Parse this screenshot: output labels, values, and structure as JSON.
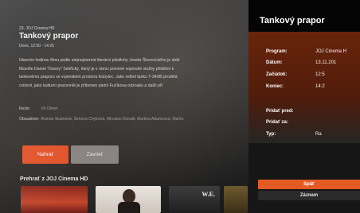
{
  "detail": {
    "channel_line": "23. JOJ Cinema HD",
    "title": "Tankový prapor",
    "time": "Dnes, 12:50 - 14:25",
    "description_lines": [
      "Hlavním hrdinou filmu podle stejnojmenné literární předlohy Josefa Škvoreckého je dokt",
      "filosofie Daniel \"Danny\" Smiřický, který je v rámci povinné vojenské služby přidělen k",
      "tankovému praporu ve vojenském prostoru Kobylec. Jako velitel tanku T-34/85 prodělá",
      "cvičení, jako kulturní pracovník je přítomen pietní Fučíkova odznaku a další při"
    ],
    "director_label": "Režie:",
    "director_value": "Vít Olmer",
    "cast_label": "Obsadenie:",
    "cast_value": "Roman Skamene, Simona Chytrová, Miroslav Donutil, Martina Adamcová, Martin",
    "record_button": "Nahrať",
    "close_button": "Zavrieť",
    "related_title": "Prehrať z JOJ Cinema HD",
    "thumb3_text": "W.E."
  },
  "panel": {
    "title": "Tankový prapor",
    "rows": [
      {
        "label": "Program:",
        "value": "JOJ Cinema H"
      },
      {
        "label": "Dátum:",
        "value": "13.11.201"
      },
      {
        "label": "Začiatok:",
        "value": "12:5"
      },
      {
        "label": "Koniec:",
        "value": "14:2"
      },
      {
        "label": "Pridať pred:",
        "value": ""
      },
      {
        "label": "Pridať za:",
        "value": ""
      },
      {
        "label": "Typ:",
        "value": "Ra"
      }
    ],
    "back_button": "Späť",
    "record_button": "Záznam"
  },
  "colors": {
    "accent": "#e35a22",
    "panel_body": "#7a2a0c",
    "close_button": "#8a8582"
  }
}
